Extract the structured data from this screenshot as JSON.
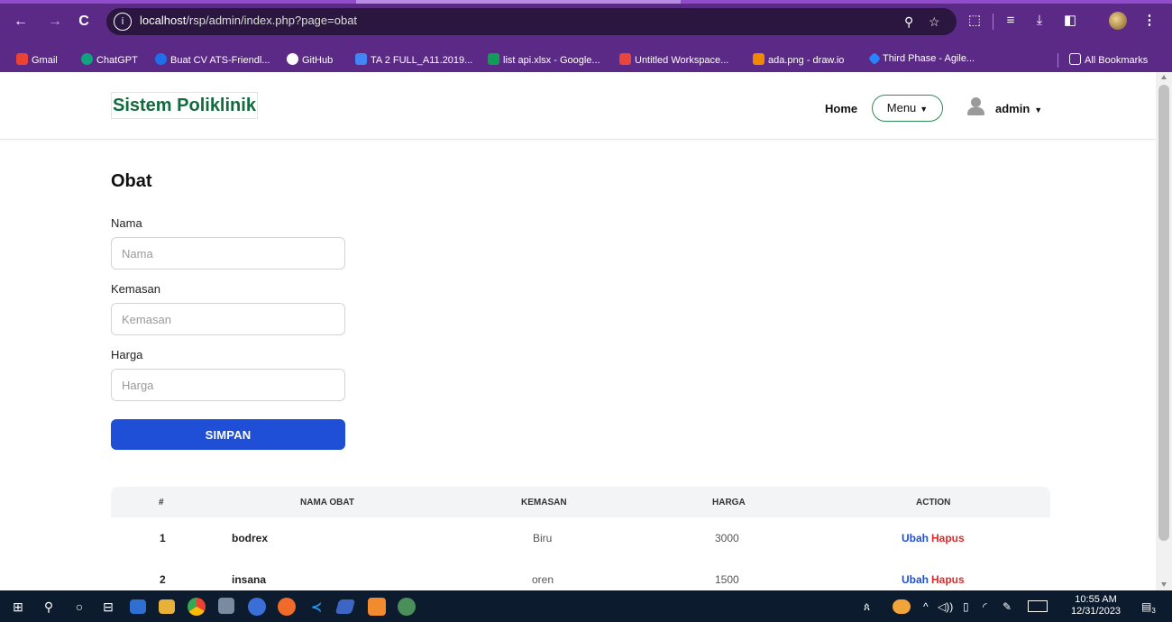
{
  "browser": {
    "url_host": "localhost",
    "url_path": "/rsp/admin/index.php?page=obat",
    "bookmarks": [
      {
        "label": "Gmail",
        "color": "#ea4335"
      },
      {
        "label": "ChatGPT",
        "color": "#10a37f"
      },
      {
        "label": "Buat CV ATS-Friendl...",
        "color": "#1f6feb"
      },
      {
        "label": "GitHub",
        "color": "#ffffff"
      },
      {
        "label": "TA 2 FULL_A11.2019...",
        "color": "#4285f4"
      },
      {
        "label": "list api.xlsx - Google...",
        "color": "#0f9d58"
      },
      {
        "label": "Untitled Workspace...",
        "color": "#e8453c"
      },
      {
        "label": "ada.png - draw.io",
        "color": "#f08705"
      },
      {
        "label": "Third Phase - Agile...",
        "color": "#2684ff"
      }
    ],
    "all_bookmarks": "All Bookmarks"
  },
  "navbar": {
    "brand": "Sistem Poliklinik",
    "home": "Home",
    "menu": "Menu",
    "user": "admin"
  },
  "form": {
    "title": "Obat",
    "nama_label": "Nama",
    "nama_placeholder": "Nama",
    "kemasan_label": "Kemasan",
    "kemasan_placeholder": "Kemasan",
    "harga_label": "Harga",
    "harga_placeholder": "Harga",
    "submit": "SIMPAN"
  },
  "table": {
    "headers": [
      "#",
      "NAMA OBAT",
      "KEMASAN",
      "HARGA",
      "ACTION"
    ],
    "rows": [
      {
        "no": "1",
        "nama": "bodrex",
        "kemasan": "Biru",
        "harga": "3000"
      },
      {
        "no": "2",
        "nama": "insana",
        "kemasan": "oren",
        "harga": "1500"
      }
    ],
    "action_edit": "Ubah",
    "action_delete": "Hapus"
  },
  "taskbar": {
    "time": "10:55 AM",
    "date": "12/31/2023",
    "notification_count": "3"
  },
  "colors": {
    "chrome": "#5b2a86",
    "brand": "#116b3e",
    "primary": "#1f4fd6",
    "danger": "#d92d2d",
    "taskbar": "#0d1b2e"
  }
}
